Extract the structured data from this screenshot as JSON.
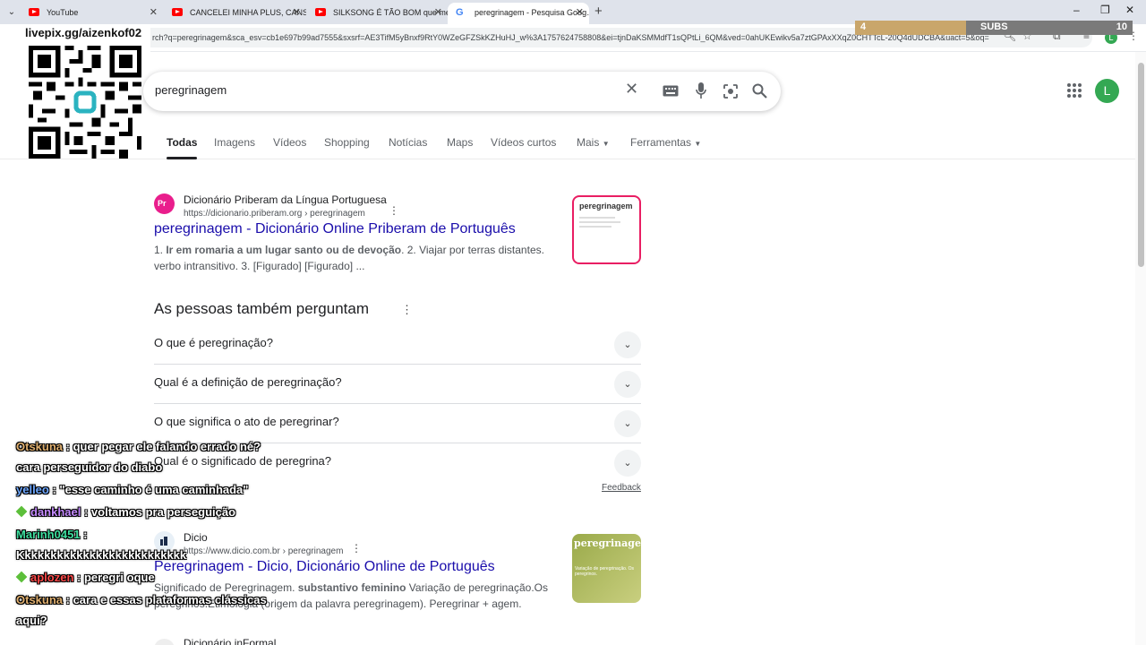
{
  "browser": {
    "tabs": [
      {
        "title": "YouTube",
        "icon": "youtube-favicon-icon"
      },
      {
        "title": "CANCELEI MINHA PLUS, CANS…",
        "icon": "youtube-favicon-icon"
      },
      {
        "title": "SILKSONG É TÃO BOM que me…",
        "icon": "youtube-favicon-icon"
      },
      {
        "title": "peregrinagem - Pesquisa Goog…",
        "icon": "google-favicon-icon"
      }
    ],
    "url": "rch?q=peregrinagem&sca_esv=cb1e697b99ad7555&sxsrf=AE3TifM5yBnxf9RtY0WZeGFZSkKZHuHJ_w%3A1757624758808&ei=tjnDaKSMMdfT1sQPtLi_6QM&ved=0ahUKEwikv5a7ztGPAxXXqZ0CHTTcL-20Q4dUDCBA&uact=5&oq=",
    "profile_initial": "L"
  },
  "overlay": {
    "subs_current": "4",
    "subs_label": "SUBS",
    "subs_goal": "10",
    "subs_fraction": 0.4,
    "livepix_url": "livepix.gg/aizenkof02"
  },
  "google": {
    "query": "peregrinagem",
    "avatar_initial": "L",
    "tabs": [
      "Todas",
      "Imagens",
      "Vídeos",
      "Shopping",
      "Notícias",
      "Maps",
      "Vídeos curtos",
      "Mais",
      "Ferramentas"
    ],
    "results": [
      {
        "site": "Dicionário Priberam da Língua Portuguesa",
        "url": "https://dicionario.priberam.org › peregrinagem",
        "title": "peregrinagem - Dicionário Online Priberam de Português",
        "snippet_pre": "1. ",
        "snippet_bold": "Ir em romaria a um lugar santo ou de devoção",
        "snippet_post": ". 2. Viajar por terras distantes. verbo intransitivo. 3. [Figurado] [Figurado] ...",
        "thumb_text": "peregrinagem"
      },
      {
        "site": "Dicio",
        "url": "https://www.dicio.com.br › peregrinagem",
        "title": "Peregrinagem - Dicio, Dicionário Online de Português",
        "snippet_pre": "Significado de Peregrinagem. ",
        "snippet_bold": "substantivo feminino",
        "snippet_post": " Variação de peregrinação.Os peregrinos.Etimologia (origem da palavra peregrinagem). Peregrinar + agem.",
        "thumb_text": "peregrinagem",
        "thumb_sub": "Variação de peregrinação. Os peregrinos."
      },
      {
        "site": "Dicionário inFormal"
      }
    ],
    "paa": {
      "title": "As pessoas também perguntam",
      "questions": [
        "O que é peregrinação?",
        "Qual é a definição de peregrinação?",
        "O que significa o ato de peregrinar?",
        "Qual é o significado de peregrina?"
      ],
      "feedback": "Feedback"
    }
  },
  "chat": [
    {
      "user": "Otskuna",
      "color": "#e0b070",
      "msg": ": quer pegar ele falando errado né?",
      "badge": false
    },
    {
      "user": "",
      "color": "#ffffff",
      "msg": "cara perseguidor do diabo",
      "badge": false
    },
    {
      "user": "yelleo",
      "color": "#6fa8ff",
      "msg": ": \"esse caminho é uma caminhada\"",
      "badge": false
    },
    {
      "user": "dankhael",
      "color": "#c58aff",
      "msg": ": voltamos pra perseguição",
      "badge": true
    },
    {
      "user": "Marinh0451",
      "color": "#3fe0a0",
      "msg": ":",
      "badge": false
    },
    {
      "user": "",
      "color": "#ffffff",
      "msg": "Kkkkkkkkkkkkkkkkkkkkkkkkkk",
      "badge": false
    },
    {
      "user": "aplozen",
      "color": "#ff4a4a",
      "msg": ": peregri oque",
      "badge": true
    },
    {
      "user": "Otskuna",
      "color": "#e0b070",
      "msg": ": cara e essas plataformas clássicas",
      "badge": false
    },
    {
      "user": "",
      "color": "#ffffff",
      "msg": "aqui?",
      "badge": false
    }
  ]
}
